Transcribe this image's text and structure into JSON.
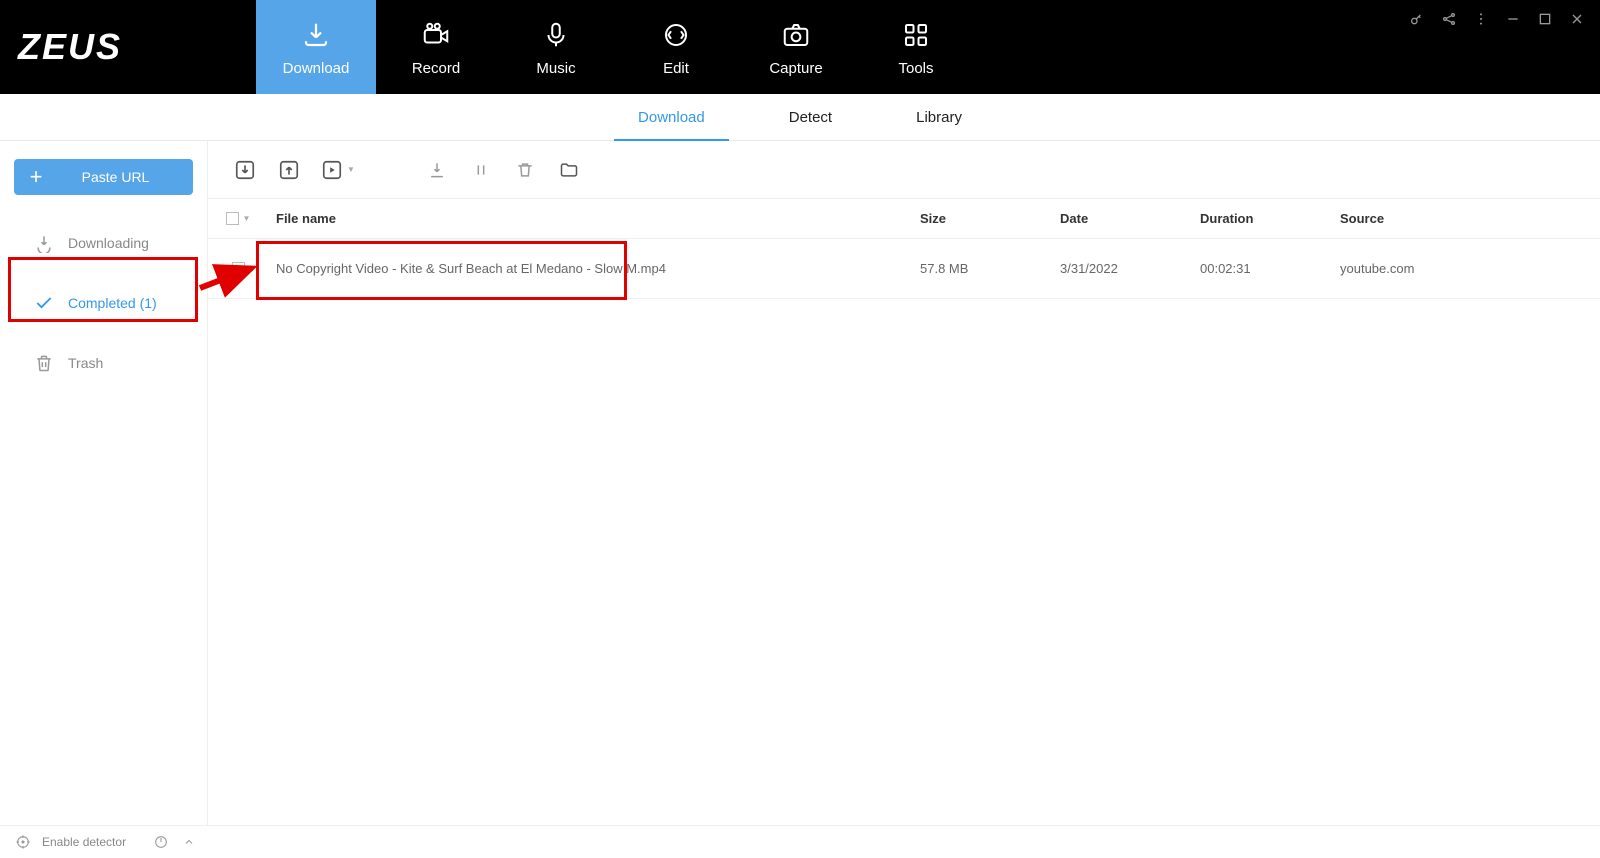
{
  "app": {
    "name": "ZEUS"
  },
  "top_tabs": [
    {
      "label": "Download",
      "active": true
    },
    {
      "label": "Record",
      "active": false
    },
    {
      "label": "Music",
      "active": false
    },
    {
      "label": "Edit",
      "active": false
    },
    {
      "label": "Capture",
      "active": false
    },
    {
      "label": "Tools",
      "active": false
    }
  ],
  "sub_tabs": [
    {
      "label": "Download",
      "active": true
    },
    {
      "label": "Detect",
      "active": false
    },
    {
      "label": "Library",
      "active": false
    }
  ],
  "paste_url_button": "Paste URL",
  "sidebar": {
    "downloading": "Downloading",
    "completed": "Completed (1)",
    "trash": "Trash"
  },
  "table": {
    "headers": {
      "file_name": "File name",
      "size": "Size",
      "date": "Date",
      "duration": "Duration",
      "source": "Source"
    },
    "rows": [
      {
        "file_name": "No Copyright Video - Kite & Surf Beach at El Medano - Slow M.mp4",
        "size": "57.8 MB",
        "date": "3/31/2022",
        "duration": "00:02:31",
        "source": "youtube.com"
      }
    ]
  },
  "status": {
    "enable_detector": "Enable detector"
  }
}
